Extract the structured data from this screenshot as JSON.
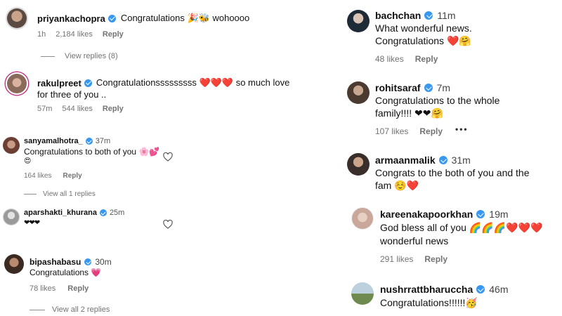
{
  "left": {
    "c1": {
      "username": "priyankachopra",
      "text": "Congratulations 🎉🐝 wohoooo",
      "time": "1h",
      "likes": "2,184 likes",
      "reply": "Reply",
      "view_replies": "View replies (8)"
    },
    "c2": {
      "username": "rakulpreet",
      "text_line1": "Congratulationsssssssss ❤️❤️❤️ so much love",
      "text_line2": "for three of you ..",
      "time": "57m",
      "likes": "544 likes",
      "reply": "Reply"
    },
    "c3": {
      "username": "sanyamalhotra_",
      "time": "37m",
      "text_line1": "Congratulations to both of you 🌸💕",
      "text_line2": "😍",
      "likes": "164 likes",
      "reply": "Reply",
      "view_replies": "View all 1 replies"
    },
    "c4": {
      "username": "aparshakti_khurana",
      "time": "25m",
      "text": "❤❤❤"
    },
    "c5": {
      "username": "bipashabasu",
      "time": "30m",
      "text": "Congratulations 💗",
      "likes": "78 likes",
      "reply": "Reply",
      "view_replies": "View all 2 replies"
    }
  },
  "right": {
    "c1": {
      "username": "bachchan",
      "time": "11m",
      "text_line1": "What wonderful news.",
      "text_line2": "Congratulations ❤️🤗",
      "likes": "48 likes",
      "reply": "Reply"
    },
    "c2": {
      "username": "rohitsaraf",
      "time": "7m",
      "text_line1": "Congratulations to the whole",
      "text_line2": "family!!!! ❤❤🤗",
      "likes": "107 likes",
      "reply": "Reply",
      "more": "•••"
    },
    "c3": {
      "username": "armaanmalik",
      "time": "31m",
      "text_line1": "Congrats to the both of you and the",
      "text_line2": "fam ☺️❤️"
    },
    "c4": {
      "username": "kareenakapoorkhan",
      "time": "19m",
      "text_line1": "God bless all of you 🌈🌈🌈❤️❤️❤️",
      "text_line2": "wonderful news",
      "likes": "291 likes",
      "reply": "Reply"
    },
    "c5": {
      "username": "nushrrattbharuccha",
      "time": "46m",
      "text": "Congratulations!!!!!!🥳"
    }
  },
  "colors": {
    "verified": "#3897f0",
    "meta": "#737373",
    "story_ring": "#c13584"
  },
  "icons": {
    "verified": "verified-badge-icon",
    "like": "heart-outline-icon",
    "more": "more-options-icon"
  }
}
